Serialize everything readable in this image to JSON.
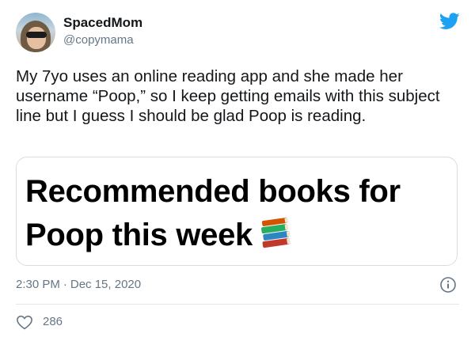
{
  "user": {
    "name": "SpacedMom",
    "handle": "@copymama"
  },
  "tweet": {
    "text": "My 7yo uses an online reading app and she made her username “Poop,” so I keep getting emails with this subject line but I guess I should be glad Poop is reading.",
    "media": {
      "line1": "Recommended books for",
      "line2": "Poop this week"
    },
    "time": "2:30 PM",
    "separator": "·",
    "date": "Dec 15, 2020",
    "likes": "286"
  },
  "icons": {
    "brand": "twitter-bird-icon",
    "media_emoji": "books-icon",
    "info": "info-icon",
    "like": "heart-icon"
  },
  "colors": {
    "twitter_blue": "#1da1f2",
    "secondary_text": "#657786",
    "primary_text": "#14171a"
  }
}
